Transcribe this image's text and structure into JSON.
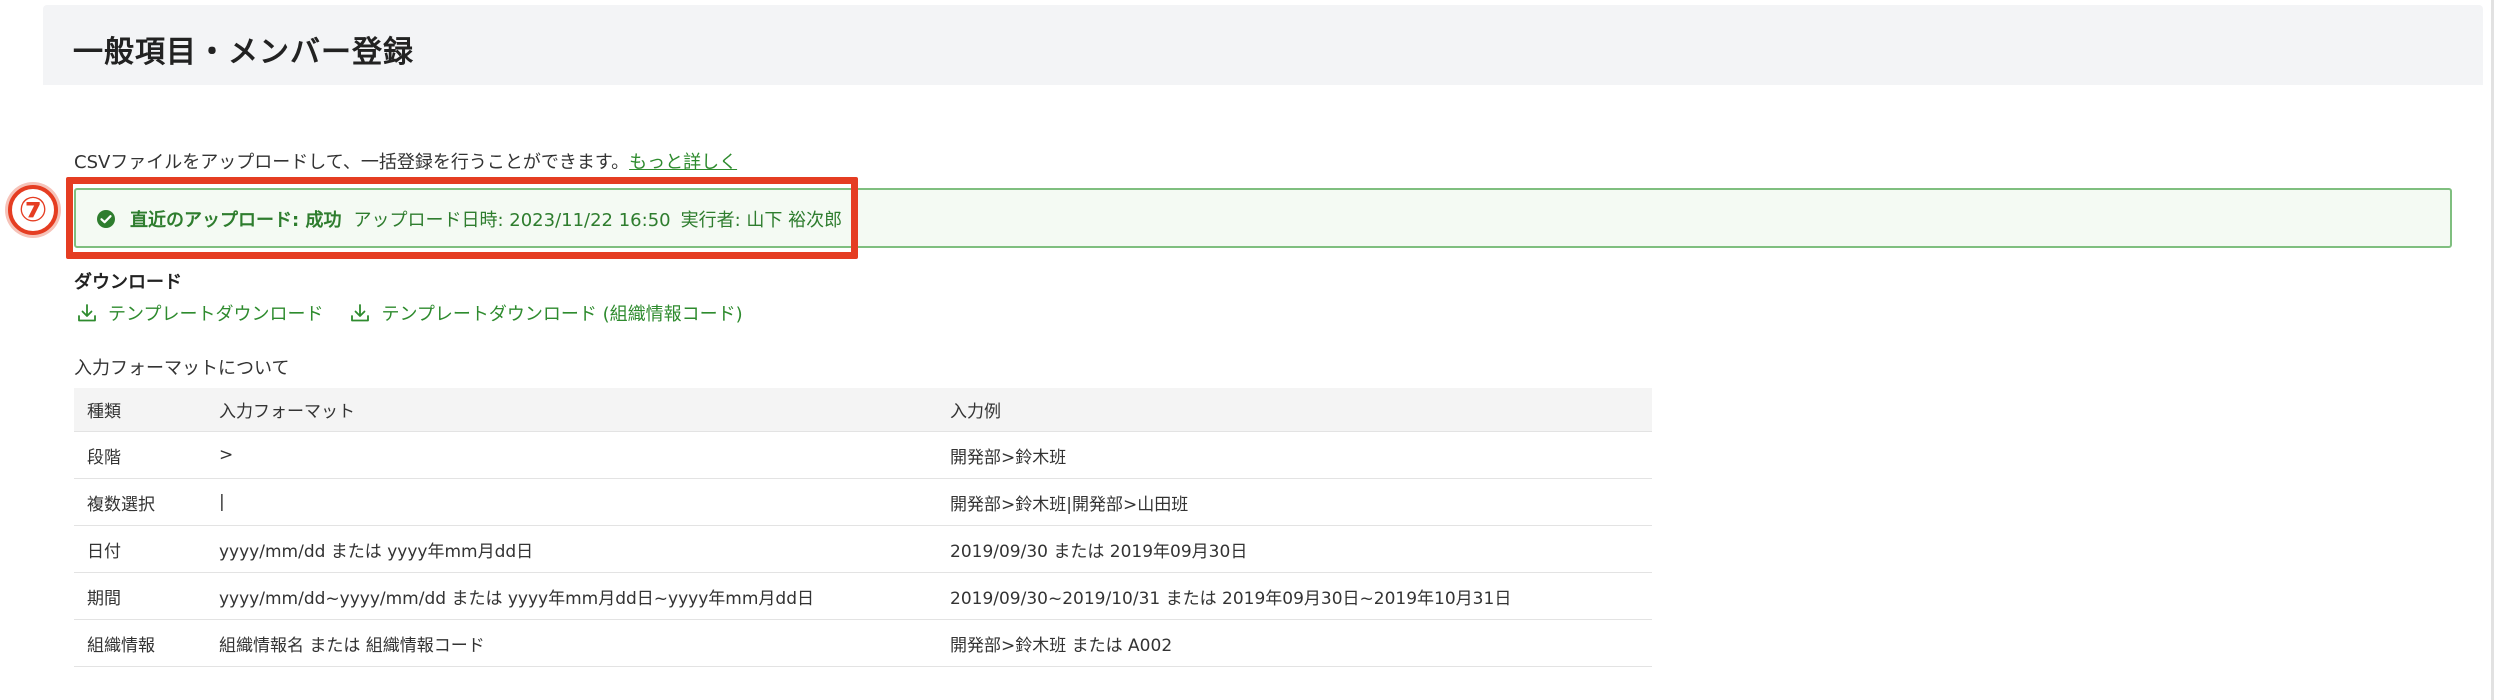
{
  "header": {
    "title": "一般項目・メンバー登録"
  },
  "intro": {
    "text": "CSVファイルをアップロードして、一括登録を行うことができます。",
    "link": "もっと詳しく"
  },
  "status": {
    "icon": "check-circle-icon",
    "label": "直近のアップロード: 成功",
    "datetime": "アップロード日時: 2023/11/22 16:50",
    "executor": "実行者: 山下 裕次郎",
    "color": "#2e7d2e"
  },
  "annotation": {
    "number": "⑦",
    "color": "#e53d22"
  },
  "downloads": {
    "heading": "ダウンロード",
    "items": [
      {
        "label": "テンプレートダウンロード",
        "icon": "download-icon"
      },
      {
        "label": "テンプレートダウンロード (組織情報コード)",
        "icon": "download-icon"
      }
    ]
  },
  "format": {
    "heading": "入力フォーマットについて",
    "columns": [
      "種類",
      "入力フォーマット",
      "入力例"
    ],
    "rows": [
      [
        "段階",
        ">",
        "開発部>鈴木班"
      ],
      [
        "複数選択",
        "|",
        "開発部>鈴木班|開発部>山田班"
      ],
      [
        "日付",
        "yyyy/mm/dd または yyyy年mm月dd日",
        "2019/09/30 または 2019年09月30日"
      ],
      [
        "期間",
        "yyyy/mm/dd~yyyy/mm/dd または yyyy年mm月dd日~yyyy年mm月dd日",
        "2019/09/30~2019/10/31 または 2019年09月30日~2019年10月31日"
      ],
      [
        "組織情報",
        "組織情報名 または 組織情報コード",
        "開発部>鈴木班 または A002"
      ]
    ]
  }
}
